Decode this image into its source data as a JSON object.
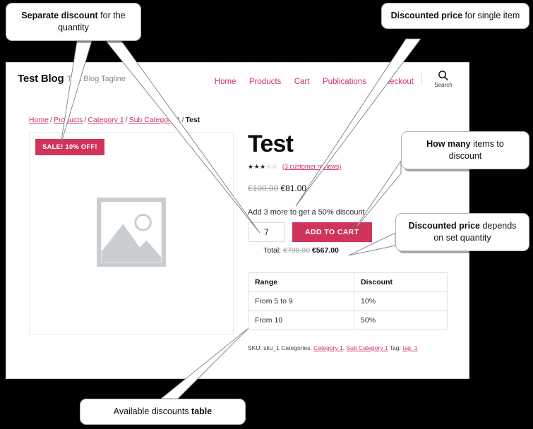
{
  "theme": {
    "accent": "#d1345b",
    "page_bg": "#ffffff",
    "canvas_bg": "#000000",
    "muted_text": "#9b9b9b"
  },
  "site": {
    "brand": "Test Blog",
    "tagline": "Test Blog Tagline",
    "nav": [
      {
        "label": "Home"
      },
      {
        "label": "Products"
      },
      {
        "label": "Cart"
      },
      {
        "label": "Publications"
      },
      {
        "label": "Checkout"
      }
    ],
    "search": {
      "icon": "search-icon",
      "label": "Search"
    }
  },
  "breadcrumb": {
    "items": [
      {
        "label": "Home",
        "link": true
      },
      {
        "label": "Products",
        "link": true
      },
      {
        "label": "Category 1",
        "link": true
      },
      {
        "label": "Sub Category 1",
        "link": true
      },
      {
        "label": "Test",
        "link": false
      }
    ],
    "separator": "/"
  },
  "gallery": {
    "sale_badge": "SALE! 10% OFF!",
    "placeholder_icon": "image-placeholder-icon"
  },
  "product": {
    "title": "Test",
    "rating": {
      "value": 3,
      "max": 5,
      "filled": "★★★",
      "empty": "☆☆"
    },
    "reviews_link": "(3 customer reviews)",
    "price_old": "€100.00",
    "price_new": "€81.00",
    "discount_hint": "Add 3 more to get a 50% discount",
    "quantity": "7",
    "quantity_placeholder": "1",
    "add_to_cart": "ADD TO CART",
    "total_label": "Total:",
    "total_old": "€700.00",
    "total_new": "€567.00"
  },
  "discount_table": {
    "headers": [
      "Range",
      "Discount"
    ],
    "rows": [
      [
        "From 5 to 9",
        "10%"
      ],
      [
        "From 10",
        "50%"
      ]
    ]
  },
  "meta": {
    "sku_label": "SKU:",
    "sku_value": "sku_1",
    "categories_label": "Categories:",
    "category_1": "Category 1",
    "category_sep": ",",
    "category_2": "Sub Category 1",
    "tag_label": "Tag:",
    "tag_value": "tag_1"
  },
  "callouts": [
    {
      "id": 1,
      "bold": "Separate discount",
      "rest": " for the quantity"
    },
    {
      "id": 2,
      "bold": "Discounted price",
      "rest": " for single item"
    },
    {
      "id": 3,
      "bold": "How many",
      "rest": " items to discount"
    },
    {
      "id": 4,
      "bold": "Discounted price",
      "rest": " depends on set quantity"
    },
    {
      "id": 5,
      "pre": "Available discounts ",
      "bold": "table",
      "rest": ""
    }
  ]
}
